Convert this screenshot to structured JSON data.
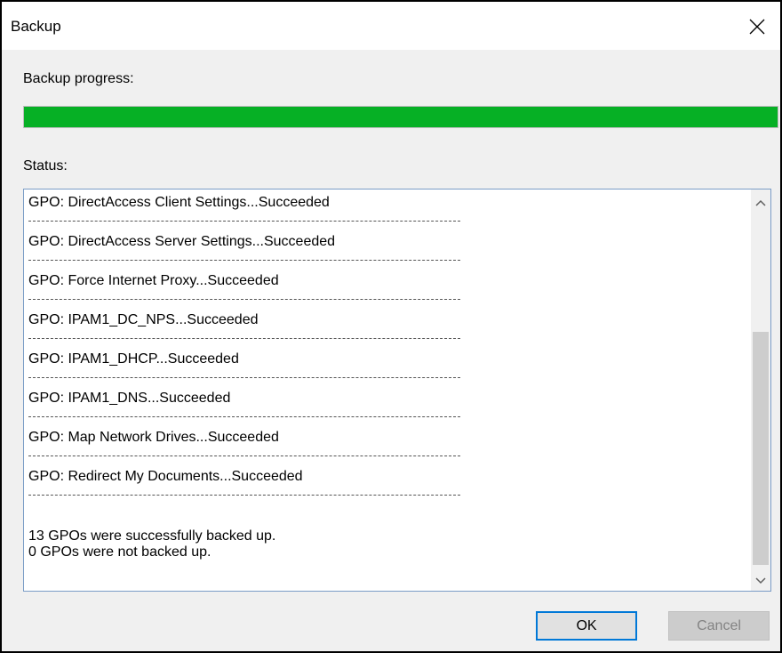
{
  "window": {
    "title": "Backup",
    "close_icon": "close-icon"
  },
  "progress": {
    "label": "Backup progress:",
    "percent": 100,
    "color": "#06b025"
  },
  "status": {
    "label": "Status:",
    "entries": [
      "GPO: DirectAccess Client Settings...Succeeded",
      "GPO: DirectAccess Server Settings...Succeeded",
      "GPO: Force Internet Proxy...Succeeded",
      "GPO: IPAM1_DC_NPS...Succeeded",
      "GPO: IPAM1_DHCP...Succeeded",
      "GPO: IPAM1_DNS...Succeeded",
      "GPO: Map Network Drives...Succeeded",
      "GPO: Redirect My Documents...Succeeded"
    ],
    "summary_line1": "13 GPOs were successfully backed up.",
    "summary_line2": "0 GPOs were not backed up."
  },
  "buttons": {
    "ok_label": "OK",
    "cancel_label": "Cancel"
  },
  "colors": {
    "focus_border": "#0078d7",
    "status_border": "#7a9cc6"
  }
}
